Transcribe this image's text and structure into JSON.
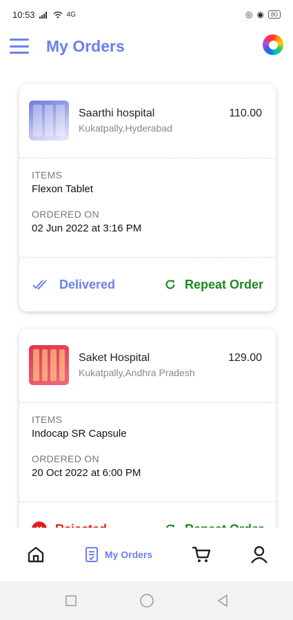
{
  "status_bar": {
    "time": "10:53",
    "network": "4G",
    "battery": "80"
  },
  "header": {
    "title": "My Orders",
    "menu_icon": "hamburger-menu-icon",
    "profile_icon": "profile-color-icon"
  },
  "orders": [
    {
      "hospital": "Saarthi hospital",
      "location": "Kukatpally,Hyderabad",
      "amount": "110.00",
      "items_label": "ITEMS",
      "items_value": "Flexon Tablet",
      "ordered_label": "ORDERED ON",
      "ordered_value": "02 Jun 2022 at 3:16 PM",
      "status": "Delivered",
      "status_icon": "double-check-icon",
      "status_color": "#6a7ef0",
      "repeat_label": "Repeat Order"
    },
    {
      "hospital": "Saket Hospital",
      "location": "Kukatpally,Andhra Pradesh",
      "amount": "129.00",
      "items_label": "ITEMS",
      "items_value": "Indocap SR Capsule",
      "ordered_label": "ORDERED ON",
      "ordered_value": "20 Oct 2022 at 6:00 PM",
      "status": "Rejected",
      "status_icon": "close-circle-icon",
      "status_color": "#e02020",
      "repeat_label": "Repeat Order"
    }
  ],
  "bottom_nav": {
    "items": [
      {
        "icon": "home-icon"
      },
      {
        "icon": "orders-icon",
        "label": "My Orders"
      },
      {
        "icon": "cart-icon"
      },
      {
        "icon": "user-icon"
      }
    ],
    "active_color": "#6a7ef0"
  },
  "colors": {
    "accent": "#6a7ef0",
    "repeat": "#1e8a1e",
    "rejected": "#e02020"
  }
}
